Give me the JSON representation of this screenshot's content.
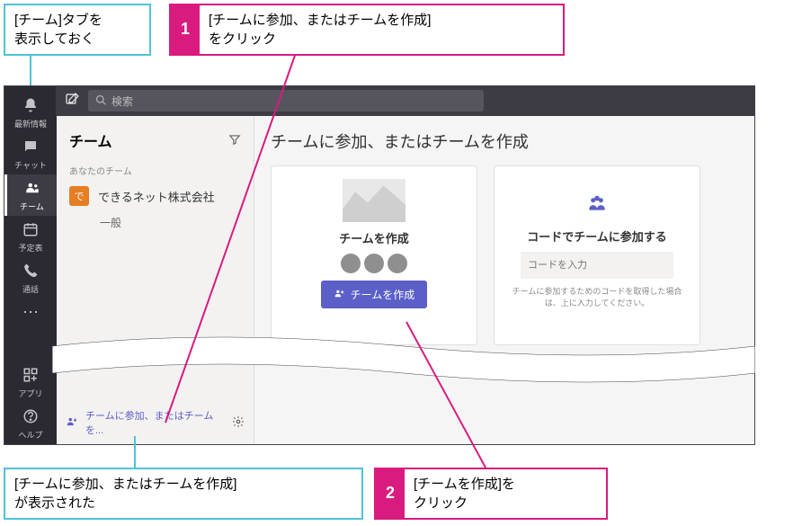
{
  "callouts": {
    "pre_blue": "[チーム]タブを\n表示しておく",
    "step1_num": "1",
    "step1_text": "[チームに参加、またはチームを作成]\nをクリック",
    "post_blue": "[チームに参加、またはチームを作成]\nが表示された",
    "step2_num": "2",
    "step2_text": "[チームを作成]を\nクリック"
  },
  "rail": {
    "activity": "最新情報",
    "chat": "チャット",
    "teams": "チーム",
    "calendar": "予定表",
    "calls": "通話",
    "apps": "アプリ",
    "help": "ヘルプ"
  },
  "sidebar": {
    "title": "チーム",
    "your_teams": "あなたのチーム",
    "team_initial": "で",
    "team_name": "できるネット株式会社",
    "channel": "一般",
    "join_link": "チームに参加、またはチームを..."
  },
  "search": {
    "placeholder": "検索"
  },
  "main": {
    "title": "チームに参加、またはチームを作成",
    "create": {
      "title": "チームを作成",
      "button": "チームを作成"
    },
    "join": {
      "title": "コードでチームに参加する",
      "placeholder": "コードを入力",
      "hint": "チームに参加するためのコードを取得した場合は、上に入力してください。"
    }
  }
}
